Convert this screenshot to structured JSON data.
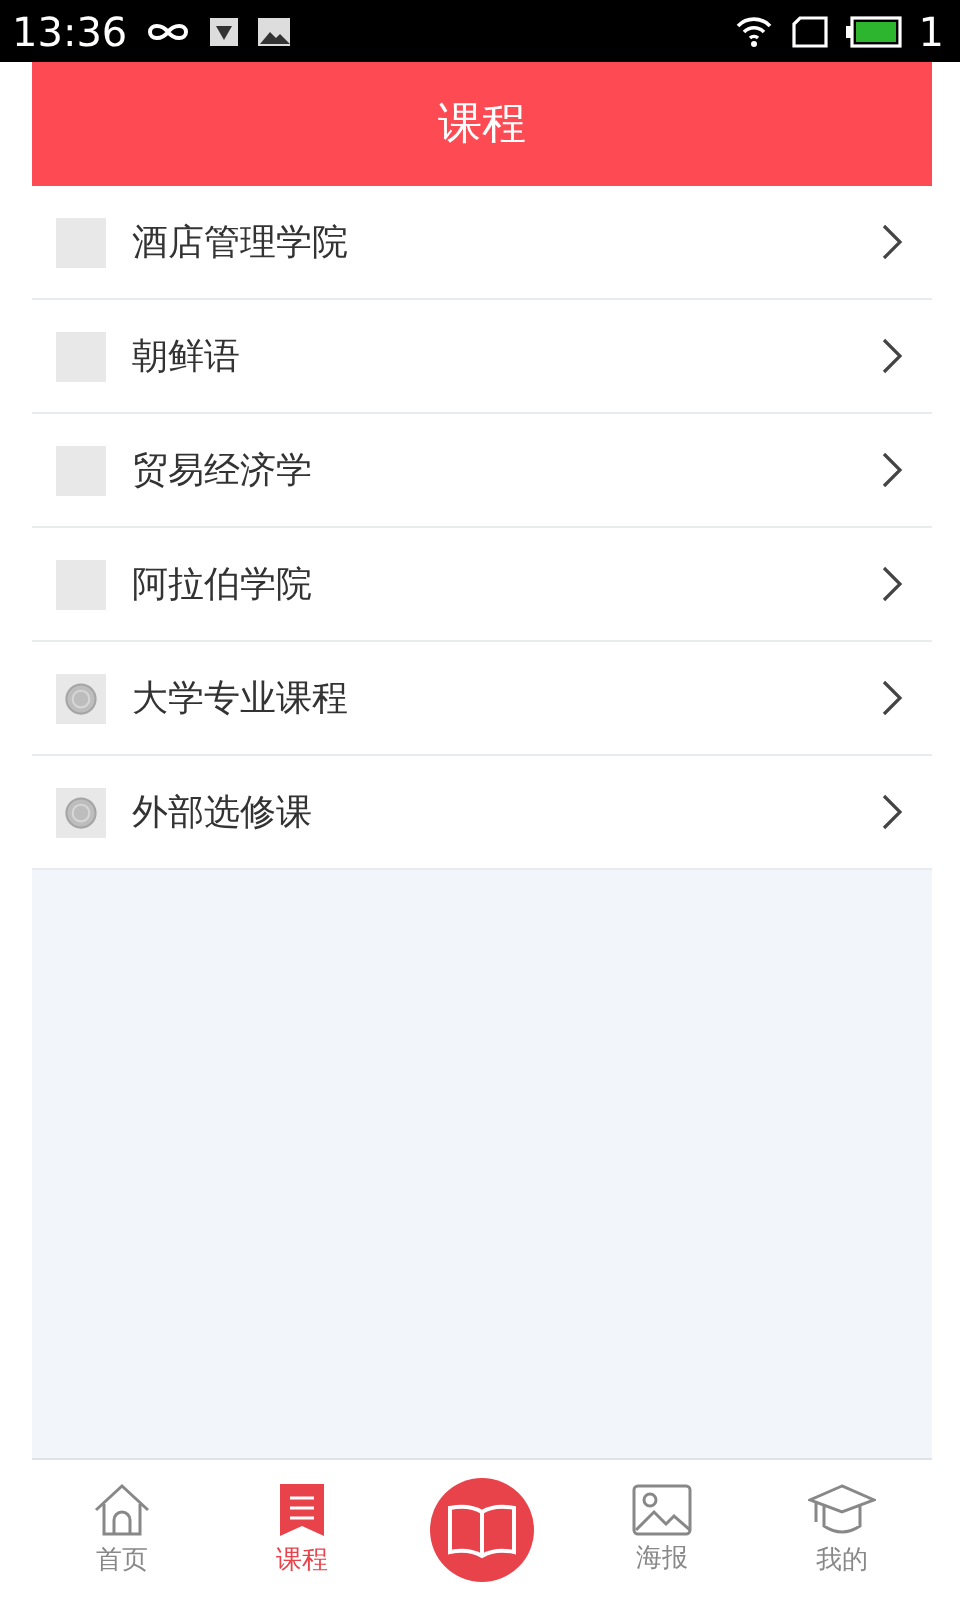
{
  "status_bar": {
    "time": "13:36",
    "battery_text": "1"
  },
  "header": {
    "title": "课程"
  },
  "courses": [
    {
      "name": "酒店管理学院",
      "kind": "blank"
    },
    {
      "name": "朝鲜语",
      "kind": "blank"
    },
    {
      "name": "贸易经济学",
      "kind": "blank"
    },
    {
      "name": "阿拉伯学院",
      "kind": "blank"
    },
    {
      "name": "大学专业课程",
      "kind": "coin"
    },
    {
      "name": "外部选修课",
      "kind": "coin"
    }
  ],
  "tabs": [
    {
      "label": "首页",
      "kind": "home",
      "selected": false
    },
    {
      "label": "课程",
      "kind": "list",
      "selected": true
    },
    {
      "kind": "book",
      "selected": false
    },
    {
      "label": "海报",
      "kind": "poster",
      "selected": false
    },
    {
      "label": "我的",
      "kind": "cap",
      "selected": false
    }
  ]
}
